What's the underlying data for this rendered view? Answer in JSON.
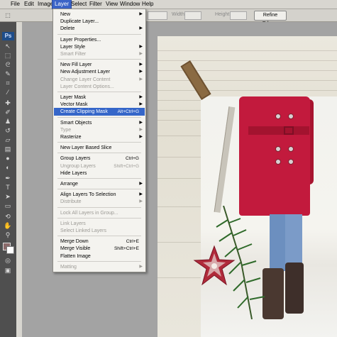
{
  "menubar": {
    "items": [
      "File",
      "Edit",
      "Image",
      "Layer",
      "Select",
      "Filter",
      "View",
      "Window",
      "Help"
    ],
    "active": "Layer"
  },
  "options_bar": {
    "width_label": "Width:",
    "height_label": "Height:",
    "refine_edge": "Refine Edge..."
  },
  "toolbox": {
    "logo": "Ps",
    "fg_color": "#8b6a6a",
    "bg_color": "#ffffff"
  },
  "layer_menu": {
    "groups": [
      [
        {
          "label": "New",
          "submenu": true
        },
        {
          "label": "Duplicate Layer...",
          "submenu": false
        },
        {
          "label": "Delete",
          "submenu": true
        }
      ],
      [
        {
          "label": "Layer Properties...",
          "submenu": false
        },
        {
          "label": "Layer Style",
          "submenu": true
        },
        {
          "label": "Smart Filter",
          "submenu": true,
          "disabled": true
        }
      ],
      [
        {
          "label": "New Fill Layer",
          "submenu": true
        },
        {
          "label": "New Adjustment Layer",
          "submenu": true
        },
        {
          "label": "Change Layer Content",
          "submenu": true,
          "disabled": true
        },
        {
          "label": "Layer Content Options...",
          "disabled": true
        }
      ],
      [
        {
          "label": "Layer Mask",
          "submenu": true
        },
        {
          "label": "Vector Mask",
          "submenu": true
        },
        {
          "label": "Create Clipping Mask",
          "shortcut": "Alt+Ctrl+G",
          "highlighted": true
        }
      ],
      [
        {
          "label": "Smart Objects",
          "submenu": true
        },
        {
          "label": "Type",
          "submenu": true,
          "disabled": true
        },
        {
          "label": "Rasterize",
          "submenu": true
        }
      ],
      [
        {
          "label": "New Layer Based Slice"
        }
      ],
      [
        {
          "label": "Group Layers",
          "shortcut": "Ctrl+G"
        },
        {
          "label": "Ungroup Layers",
          "shortcut": "Shift+Ctrl+G",
          "disabled": true
        },
        {
          "label": "Hide Layers"
        }
      ],
      [
        {
          "label": "Arrange",
          "submenu": true
        }
      ],
      [
        {
          "label": "Align Layers To Selection",
          "submenu": true
        },
        {
          "label": "Distribute",
          "submenu": true,
          "disabled": true
        }
      ],
      [
        {
          "label": "Lock All Layers in Group...",
          "disabled": true
        }
      ],
      [
        {
          "label": "Link Layers",
          "disabled": true
        },
        {
          "label": "Select Linked Layers",
          "disabled": true
        }
      ],
      [
        {
          "label": "Merge Down",
          "shortcut": "Ctrl+E"
        },
        {
          "label": "Merge Visible",
          "shortcut": "Shift+Ctrl+E"
        },
        {
          "label": "Flatten Image"
        }
      ],
      [
        {
          "label": "Matting",
          "submenu": true,
          "disabled": true
        }
      ]
    ]
  },
  "colors": {
    "menu_highlight": "#3566c9",
    "coat": "#c21a3d"
  }
}
